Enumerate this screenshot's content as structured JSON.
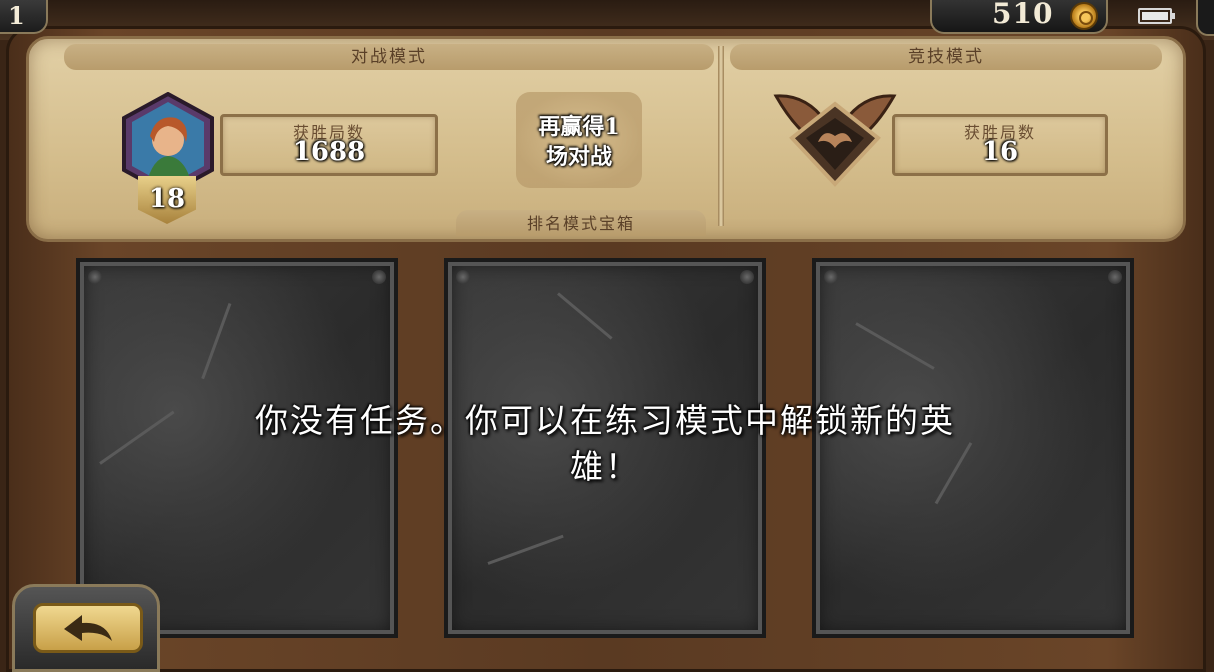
{
  "topbar": {
    "level": "1",
    "gold": "510",
    "icons": [
      "gold-coin-icon",
      "battery-icon"
    ]
  },
  "stats": {
    "play_mode": {
      "title": "对战模式",
      "wins_label": "获胜局数",
      "wins_value": "1688",
      "hero_level": "18"
    },
    "chest": {
      "progress_text_line1": "再赢得1",
      "progress_text_line2": "场对战",
      "label": "排名模式宝箱"
    },
    "arena_mode": {
      "title": "竞技模式",
      "wins_label": "获胜局数",
      "wins_value": "16"
    }
  },
  "quests": {
    "message_line1": "你没有任务。你可以在练习模式中解锁新的英",
    "message_line2": "雄！",
    "slot_count": 3
  },
  "colors": {
    "parchment": "#d4bd8c",
    "wood": "#5a3a22",
    "slot_stone": "#2f2f2f",
    "gold": "#f6c65a"
  }
}
